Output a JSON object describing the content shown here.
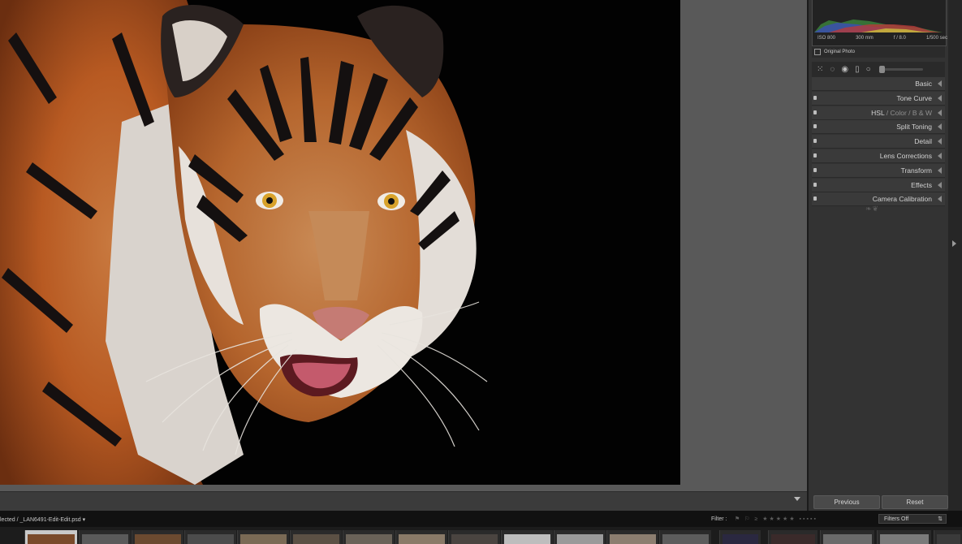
{
  "right_panel": {
    "histogram_info": {
      "iso": "ISO 800",
      "focal": "300 mm",
      "aperture": "f / 8.0",
      "shutter": "1/500 sec"
    },
    "original_photo_label": "Original Photo",
    "panels": [
      {
        "label": "Basic"
      },
      {
        "label": "Tone Curve"
      },
      {
        "hsl": "HSL",
        "sep1": " / ",
        "color": "Color",
        "sep2": " / ",
        "bw": "B & W"
      },
      {
        "label": "Split Toning"
      },
      {
        "label": "Detail"
      },
      {
        "label": "Lens Corrections"
      },
      {
        "label": "Transform"
      },
      {
        "label": "Effects"
      },
      {
        "label": "Camera Calibration"
      }
    ],
    "previous_button": "Previous",
    "reset_button": "Reset"
  },
  "filmstrip": {
    "path_text": "lected / _LAN6491-Edit-Edit.psd",
    "filter_label": "Filter :",
    "filters_value": "Filters Off"
  },
  "colors": {
    "background": "#1f1f1f",
    "panel": "#333333",
    "header_row": "#3a3a3a",
    "photo_bg": "#020202",
    "accent_orange": "#c8682a"
  }
}
